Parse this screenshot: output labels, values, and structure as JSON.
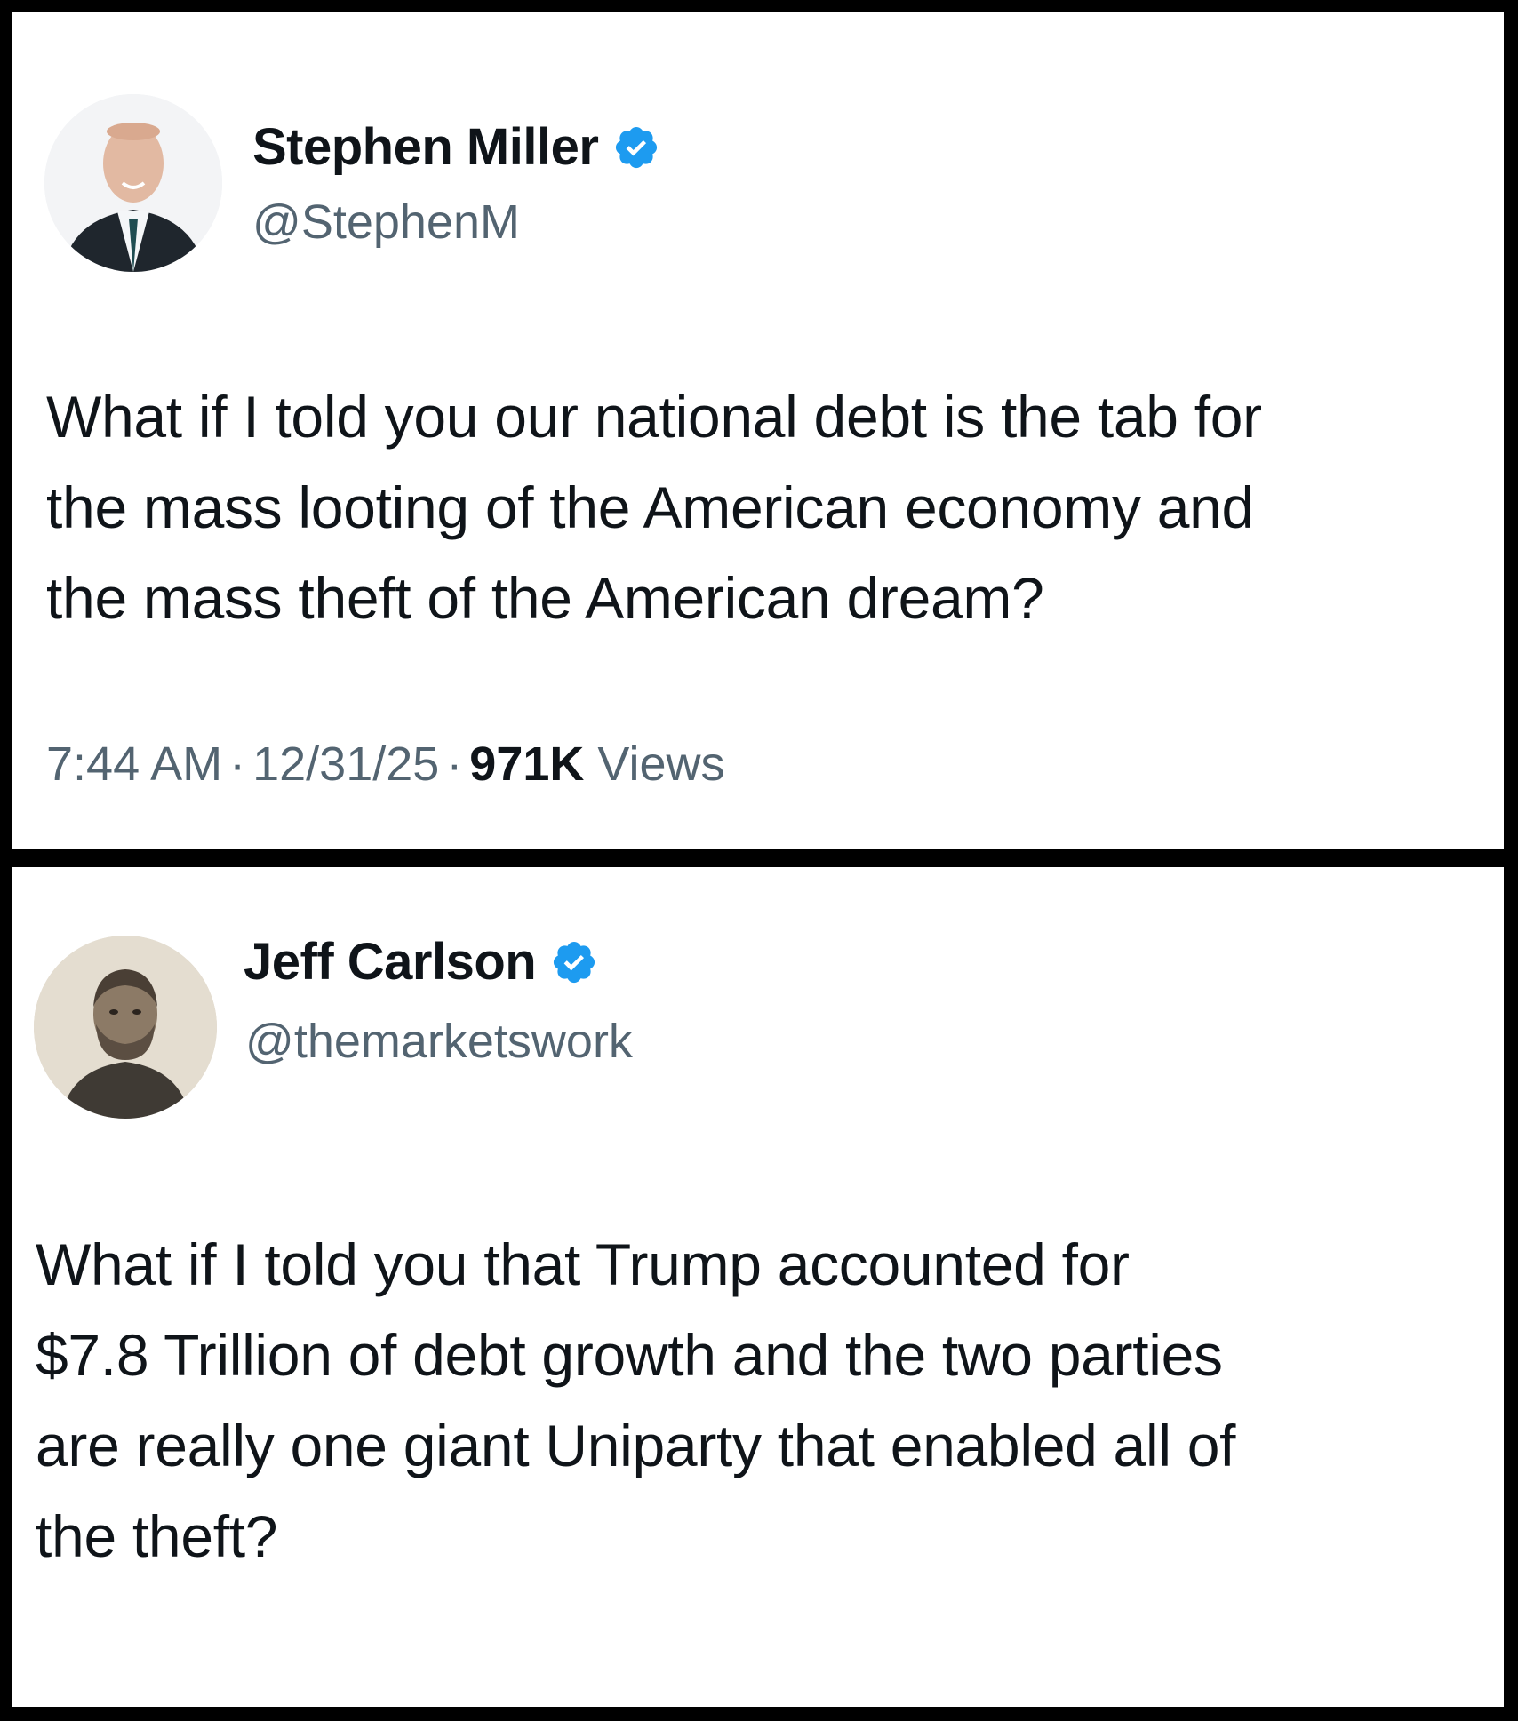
{
  "tweets": [
    {
      "display_name": "Stephen Miller",
      "handle": "@StephenM",
      "text_lines": [
        "What if I told you our national debt is the tab for",
        "the mass looting of the American economy and",
        "the mass theft of the American dream?"
      ],
      "time": "7:44 AM",
      "date": "12/31/25",
      "views_count": "971K",
      "views_label": "Views",
      "separator": "·",
      "verified_color": "#1d9bf0"
    },
    {
      "display_name": "Jeff Carlson",
      "handle": "@themarketswork",
      "text_lines": [
        "What if I told you that Trump accounted for",
        "$7.8 Trillion of debt growth and the two parties",
        "are really one giant Uniparty that enabled all of",
        "the theft?"
      ],
      "verified_color": "#1d9bf0"
    }
  ]
}
